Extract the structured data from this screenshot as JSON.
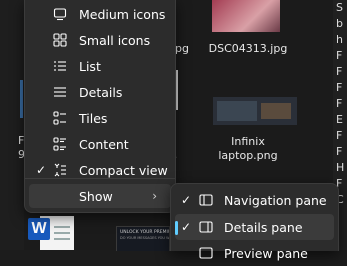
{
  "files": [
    {
      "name": "DSC04313.jpg"
    },
    {
      "name": "Infinix laptop.png"
    },
    {
      "name_partial": "jpg"
    },
    {
      "name_partial": "s"
    }
  ],
  "left_partial": [
    "F",
    "9"
  ],
  "right_column": [
    "S",
    "b",
    "h",
    "F",
    "F",
    "F",
    "F",
    "E",
    "F",
    "F",
    "H",
    "F",
    "C"
  ],
  "menu": {
    "items": [
      {
        "label": "Medium icons",
        "icon": "monitor-icon"
      },
      {
        "label": "Small icons",
        "icon": "small-icons-icon"
      },
      {
        "label": "List",
        "icon": "list-icon"
      },
      {
        "label": "Details",
        "icon": "details-icon"
      },
      {
        "label": "Tiles",
        "icon": "tiles-icon"
      },
      {
        "label": "Content",
        "icon": "content-icon"
      },
      {
        "label": "Compact view",
        "icon": "compact-view-icon",
        "checked": true
      },
      {
        "label": "Show",
        "icon": "",
        "submenu": true
      }
    ]
  },
  "submenu": {
    "items": [
      {
        "label": "Navigation pane",
        "icon": "navigation-pane-icon",
        "checked": true
      },
      {
        "label": "Details pane",
        "icon": "details-pane-icon",
        "checked": true,
        "selected": true
      },
      {
        "label": "Preview pane",
        "icon": "preview-pane-icon"
      }
    ]
  },
  "thumb_text": {
    "ad_line1": "UNLOCK YOUR PREMIUM",
    "ad_line2": "DO YOUR MESSAGES YOU WANT"
  },
  "colors": {
    "menu_bg": "#2c2c2c",
    "accent": "#60cdff",
    "word_blue": "#185abd"
  }
}
